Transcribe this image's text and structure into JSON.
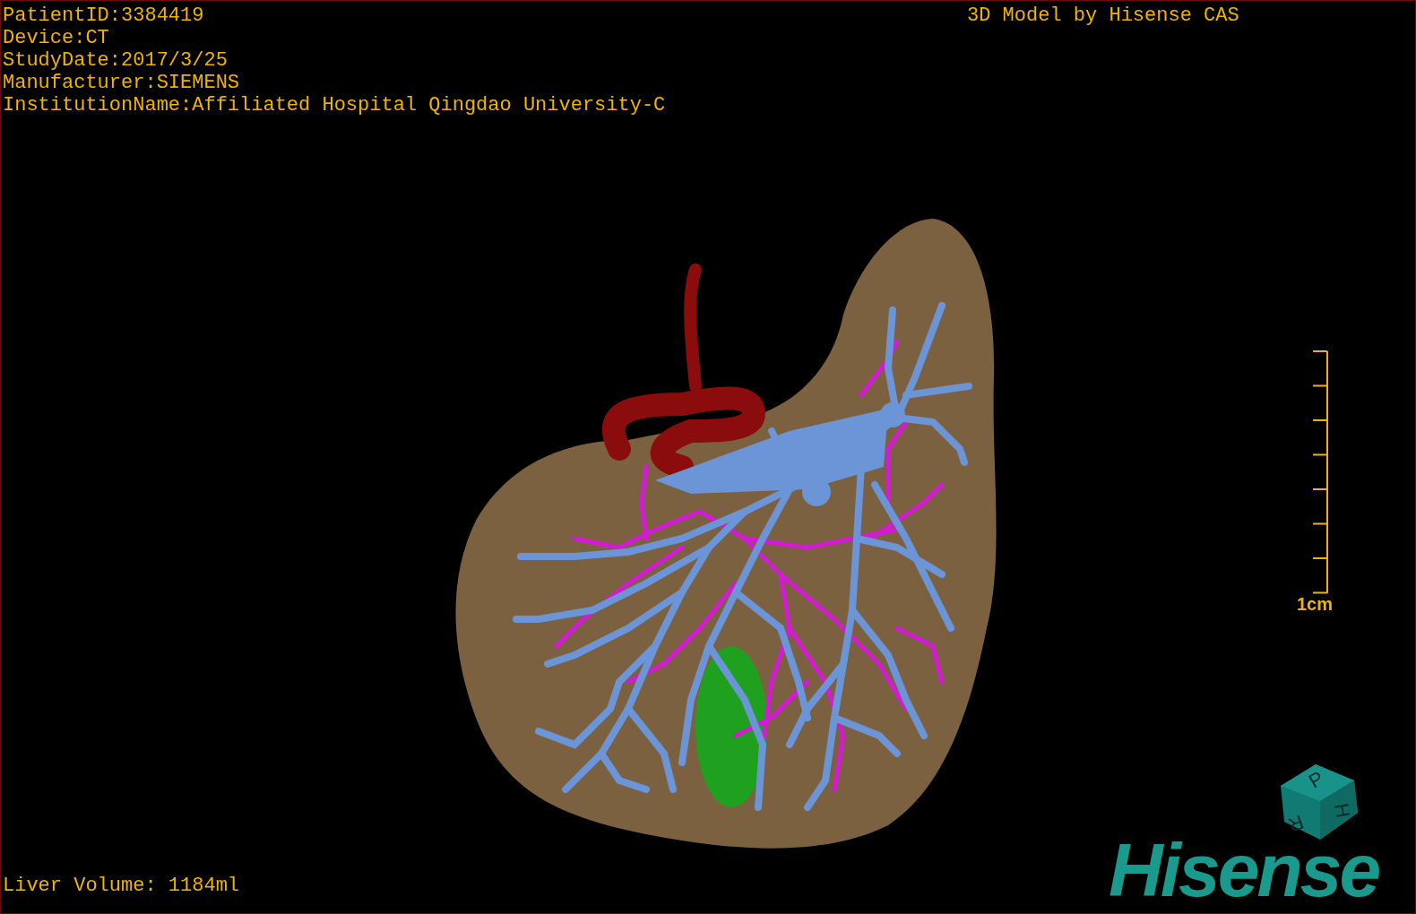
{
  "patient_info": [
    "PatientID:3384419",
    "Device:CT",
    "StudyDate:2017/3/25",
    "Manufacturer:SIEMENS",
    "InstitutionName:Affiliated Hospital Qingdao University-C"
  ],
  "title": "3D Model by Hisense CAS",
  "scale_bar": {
    "label": "1cm"
  },
  "orientation_cube": {
    "faces": [
      "P",
      "H",
      "R"
    ]
  },
  "logo": "Hisense",
  "liver_volume": "Liver Volume: 1184ml"
}
